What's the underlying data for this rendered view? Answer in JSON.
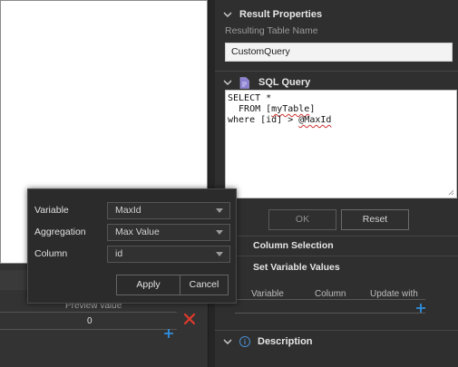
{
  "left": {
    "preview_header": "Preview value",
    "preview_value": "0"
  },
  "result_properties": {
    "title": "Result Properties",
    "table_name_label": "Resulting Table Name",
    "table_name_value": "CustomQuery"
  },
  "sql_query": {
    "title": "SQL Query",
    "line1": "SELECT *",
    "line2_prefix": "  FROM [",
    "line2_ident": "myTable",
    "line2_suffix": "]",
    "line3_prefix": "where [id] > ",
    "line3_param": "@MaxId"
  },
  "buttons": {
    "ok": "OK",
    "reset": "Reset"
  },
  "column_selection": {
    "title": "Column Selection"
  },
  "set_variable_values": {
    "title": "Set Variable Values",
    "columns": [
      "Variable",
      "Column",
      "Update with"
    ]
  },
  "description": {
    "title": "Description"
  },
  "popup": {
    "variable_label": "Variable",
    "variable_value": "MaxId",
    "aggregation_label": "Aggregation",
    "aggregation_value": "Max Value",
    "column_label": "Column",
    "column_value": "id",
    "apply": "Apply",
    "cancel": "Cancel"
  },
  "icons": {
    "delete": "x-icon",
    "add": "plus-icon",
    "info": "info-icon",
    "sql": "document-icon"
  },
  "colors": {
    "accent_blue": "#2f8fe0",
    "delete_red": "#e03a2a"
  }
}
